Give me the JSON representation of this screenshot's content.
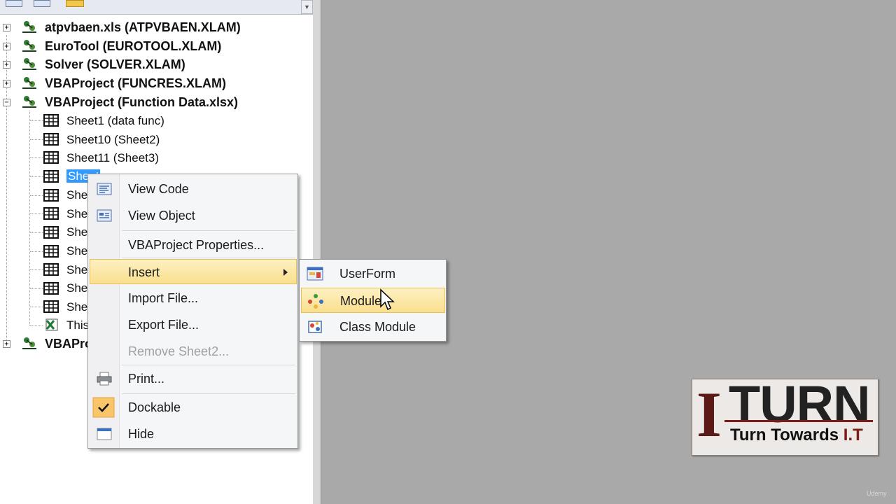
{
  "project_tree": {
    "projects": [
      {
        "label": "atpvbaen.xls (ATPVBAEN.XLAM)",
        "toggle": "+"
      },
      {
        "label": "EuroTool (EUROTOOL.XLAM)",
        "toggle": "+"
      },
      {
        "label": "Solver (SOLVER.XLAM)",
        "toggle": "+"
      },
      {
        "label": "VBAProject (FUNCRES.XLAM)",
        "toggle": "+"
      },
      {
        "label": "VBAProject (Function Data.xlsx)",
        "toggle": "−"
      },
      {
        "label": "VBAPro",
        "toggle": "+"
      }
    ],
    "sheets": [
      {
        "label": "Sheet1 (data func)"
      },
      {
        "label": "Sheet10 (Sheet2)"
      },
      {
        "label": "Sheet11 (Sheet3)"
      },
      {
        "label": "Sheet"
      },
      {
        "label": "She"
      },
      {
        "label": "She"
      },
      {
        "label": "She"
      },
      {
        "label": "She"
      },
      {
        "label": "She"
      },
      {
        "label": "She"
      },
      {
        "label": "She"
      },
      {
        "label": "This"
      }
    ]
  },
  "context_menu": {
    "items": [
      {
        "label": "View Code",
        "icon": "view-code-icon"
      },
      {
        "label": "View Object",
        "icon": "view-object-icon"
      },
      {
        "label": "VBAProject Properties..."
      },
      {
        "label": "Insert",
        "submenu": true
      },
      {
        "label": "Import File..."
      },
      {
        "label": "Export File..."
      },
      {
        "label": "Remove Sheet2...",
        "disabled": true
      },
      {
        "label": "Print...",
        "icon": "printer-icon"
      },
      {
        "label": "Dockable",
        "checked": true
      },
      {
        "label": "Hide",
        "icon": "window-icon"
      }
    ]
  },
  "insert_submenu": {
    "items": [
      {
        "label": "UserForm",
        "icon": "userform-icon"
      },
      {
        "label": "Module",
        "icon": "module-icon",
        "highlighted": true
      },
      {
        "label": "Class Module",
        "icon": "class-module-icon"
      }
    ]
  },
  "logo": {
    "letter": "I",
    "word": "TURN",
    "tagline_a": "Turn Towards",
    "tagline_b": "I.T"
  },
  "watermark": "Udemy",
  "colors": {
    "selection": "#3399ff",
    "menu_highlight": "#f9df8e",
    "logo_red": "#7a1c17"
  }
}
